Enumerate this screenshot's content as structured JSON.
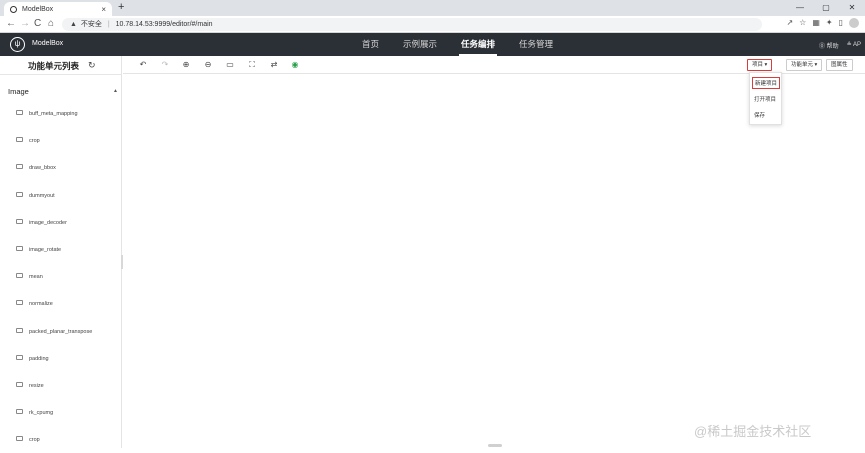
{
  "browser": {
    "tab_title": "ModelBox",
    "tab_close": "×",
    "new_tab": "+",
    "window_buttons": [
      "—",
      "▢",
      "✕"
    ],
    "nav": {
      "back": "←",
      "forward": "→",
      "reload": "C",
      "home": "⌂"
    },
    "url_warning_icon": "▲",
    "url_insecure_label": "不安全",
    "url": "10.78.14.53:9999/editor/#/main",
    "right_icons": [
      "↗",
      "☆",
      "▦",
      "✦",
      "▯"
    ]
  },
  "app": {
    "brand": "ModelBox",
    "logo_glyph": "ψ",
    "nav": [
      {
        "label": "首页",
        "active": false
      },
      {
        "label": "示例展示",
        "active": false
      },
      {
        "label": "任务编排",
        "active": true
      },
      {
        "label": "任务管理",
        "active": false
      }
    ],
    "help": "⓪ 帮助",
    "user": "≗ AP"
  },
  "sidebar": {
    "title": "功能单元列表",
    "refresh_icon": "↻",
    "category": "Image",
    "category_caret": "▲",
    "units": [
      "buff_meta_mapping",
      "crop",
      "draw_bbox",
      "dummyout",
      "image_decoder",
      "image_rotate",
      "mean",
      "normalize",
      "packed_planar_transpose",
      "padding",
      "resize",
      "rk_cpumg",
      "crop"
    ]
  },
  "toolbar": {
    "tools": [
      {
        "name": "undo-icon",
        "glyph": "↶",
        "disabled": false
      },
      {
        "name": "redo-icon",
        "glyph": "↷",
        "disabled": true
      },
      {
        "name": "zoom-in-icon",
        "glyph": "⊕",
        "disabled": false
      },
      {
        "name": "zoom-out-icon",
        "glyph": "⊖",
        "disabled": false
      },
      {
        "name": "fit-view-icon",
        "glyph": "▭",
        "disabled": false
      },
      {
        "name": "fullscreen-icon",
        "glyph": "⛶",
        "disabled": false
      },
      {
        "name": "swap-icon",
        "glyph": "⇄",
        "disabled": false
      },
      {
        "name": "run-icon",
        "glyph": "◉",
        "disabled": false
      }
    ],
    "project_button": "项目 ▾",
    "unit_button": "功能单元 ▾",
    "graph_props_button": "图属性"
  },
  "project_menu": {
    "items": [
      "新建项目",
      "打开项目",
      "保存"
    ]
  },
  "watermark": "@稀土掘金技术社区",
  "colors": {
    "header_bg": "#2b2f36",
    "highlight_border": "#d93c3c",
    "run_green": "#2aa04a"
  }
}
